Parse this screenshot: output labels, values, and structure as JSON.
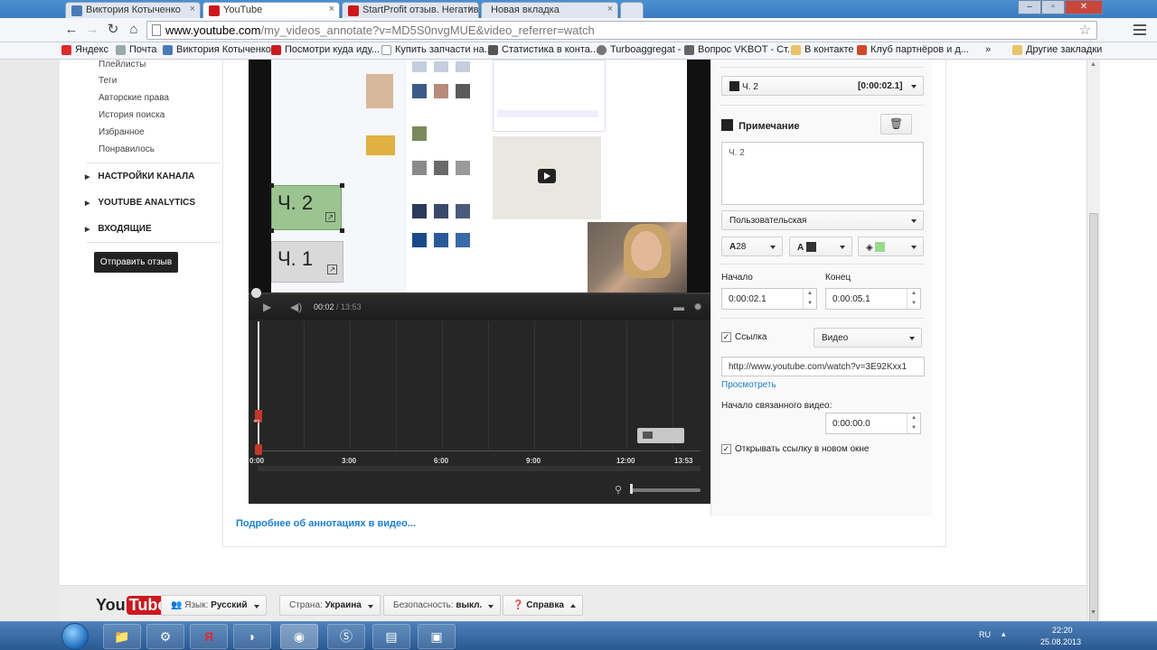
{
  "browser": {
    "tabs": [
      {
        "title": "Виктория Котыченко",
        "icon_color": "#4b7ab8"
      },
      {
        "title": "YouTube",
        "icon_color": "#cc181e"
      },
      {
        "title": "StartProfit отзыв. Негатив",
        "icon_color": "#cc181e"
      },
      {
        "title": "Новая вкладка",
        "icon_color": "#dddddd"
      }
    ],
    "window_controls": [
      "–",
      "▫",
      "✕"
    ],
    "url_host": "www.youtube.com",
    "url_path": "/my_videos_annotate?v=MD5S0nvgMUE&video_referrer=watch",
    "bookmarks": [
      "Яндекс",
      "Почта",
      "Виктория Котыченко",
      "Посмотри куда иду...",
      "Купить запчасти на...",
      "Статистика в конта...",
      "Turboaggregat -",
      "Вопрос VKBOT - Ст...",
      "В контакте",
      "Клуб партнёров и д..."
    ],
    "bookmarks_more": "»",
    "other_bookmarks": "Другие закладки"
  },
  "sidebar": {
    "items": [
      "Плейлисты",
      "Теги",
      "Авторские права",
      "История поиска",
      "Избранное",
      "Понравилось"
    ],
    "sections": [
      "НАСТРОЙКИ КАНАЛА",
      "YOUTUBE ANALYTICS",
      "ВХОДЯЩИЕ"
    ],
    "feedback_button": "Отправить отзыв"
  },
  "player": {
    "annotation_2": "Ч. 2",
    "annotation_1": "Ч. 1",
    "time_current": "00:02",
    "time_total": "/ 13:53",
    "timeline_labels": [
      "0:00",
      "3:00",
      "6:00",
      "9:00",
      "12:00",
      "13:53"
    ]
  },
  "panel": {
    "annotation_select": "Ч. 2",
    "annotation_time": "[0:00:02.1]",
    "type_label": "Примечание",
    "text": "Ч. 2",
    "style_select": "Пользовательская",
    "font_size": "28",
    "text_color_letter": "A",
    "start_label": "Начало",
    "end_label": "Конец",
    "start_value": "0:00:02.1",
    "end_value": "0:00:05.1",
    "link_label": "Ссылка",
    "link_type": "Видео",
    "link_url": "http://www.youtube.com/watch?v=3E92Kxx1",
    "preview_link": "Просмотреть",
    "linked_start_label": "Начало связанного видео:",
    "linked_start_value": "0:00:00.0",
    "new_window_label": "Открывать ссылку в новом окне",
    "colors": {
      "anno_bg": "#9bc490",
      "text_color": "#333333"
    }
  },
  "more_link": "Подробнее об аннотациях в видео...",
  "footer": {
    "logo_you": "You",
    "logo_tube": "Tube",
    "language_label": "Язык:",
    "language_value": "Русский",
    "country_label": "Страна:",
    "country_value": "Украина",
    "safety_label": "Безопасность:",
    "safety_value": "выкл.",
    "help": "Справка"
  },
  "taskbar": {
    "lang": "RU",
    "time": "22:20",
    "date": "25.08.2013"
  }
}
